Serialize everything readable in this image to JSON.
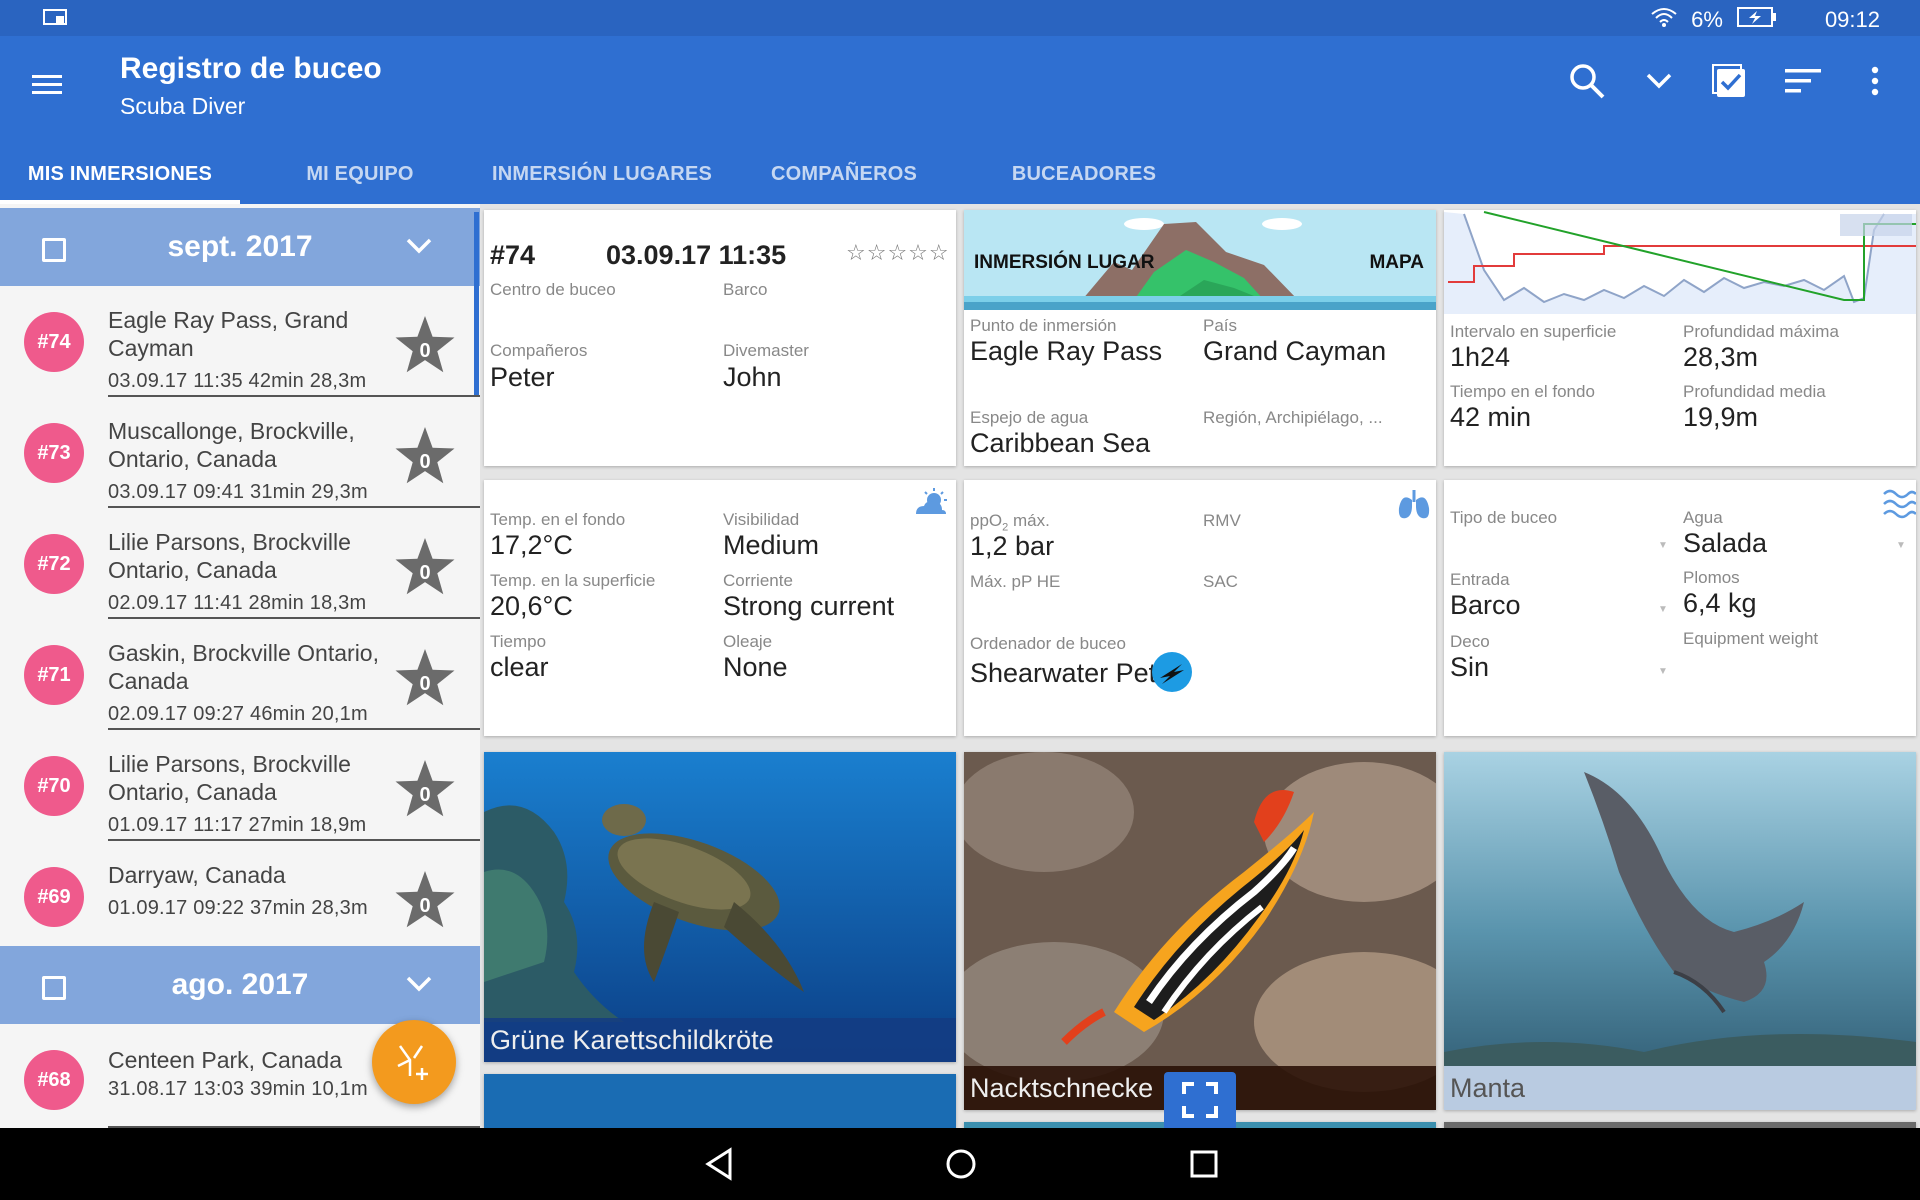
{
  "status_bar": {
    "battery": "6%",
    "time": "09:12"
  },
  "app": {
    "title": "Registro de buceo",
    "subtitle": "Scuba Diver"
  },
  "tabs": [
    "MIS INMERSIONES",
    "MI EQUIPO",
    "INMERSIÓN LUGARES",
    "COMPAÑEROS",
    "BUCEADORES"
  ],
  "months": [
    "sept. 2017",
    "ago. 2017"
  ],
  "dives": [
    {
      "num": "#74",
      "name": "Eagle Ray Pass, Grand Cayman",
      "meta": "03.09.17  11:35  42min  28,3m",
      "rating": "0"
    },
    {
      "num": "#73",
      "name": "Muscallonge, Brockville, Ontario, Canada",
      "meta": "03.09.17  09:41  31min  29,3m",
      "rating": "0"
    },
    {
      "num": "#72",
      "name": "Lilie Parsons, Brockville Ontario, Canada",
      "meta": "02.09.17  11:41  28min  18,3m",
      "rating": "0"
    },
    {
      "num": "#71",
      "name": "Gaskin, Brockville Ontario, Canada",
      "meta": "02.09.17  09:27  46min  20,1m",
      "rating": "0"
    },
    {
      "num": "#70",
      "name": "Lilie Parsons, Brockville Ontario, Canada",
      "meta": "01.09.17  11:17  27min  18,9m",
      "rating": "0"
    },
    {
      "num": "#69",
      "name": "Darryaw, Canada",
      "meta": "01.09.17  09:22  37min  28,3m",
      "rating": "0"
    },
    {
      "num": "#68",
      "name": "Centeen Park, Canada",
      "meta": "31.08.17  13:03  39min  10,1m",
      "rating": "0"
    }
  ],
  "detail": {
    "num": "#74",
    "datetime": "03.09.17  11:35",
    "stars": "☆☆☆☆☆",
    "dive_center_label": "Centro de buceo",
    "boat_label": "Barco",
    "buddies_label": "Compañeros",
    "buddies": "Peter",
    "divemaster_label": "Divemaster",
    "divemaster": "John"
  },
  "site": {
    "banner_left": "INMERSIÓN LUGAR",
    "banner_right": "MAPA",
    "point_label": "Punto de inmersión",
    "point": "Eagle Ray Pass",
    "country_label": "País",
    "country": "Grand Cayman",
    "water_label": "Espejo de agua",
    "water": "Caribbean Sea",
    "region_label": "Región, Archipiélago, ..."
  },
  "profile": {
    "surface_interval_label": "Intervalo en superficie",
    "surface_interval": "1h24",
    "max_depth_label": "Profundidad máxima",
    "max_depth": "28,3m",
    "bottom_time_label": "Tiempo en el fondo",
    "bottom_time": "42 min",
    "avg_depth_label": "Profundidad media",
    "avg_depth": "19,9m"
  },
  "conditions": {
    "bottom_temp_label": "Temp. en el fondo",
    "bottom_temp": "17,2°C",
    "visibility_label": "Visibilidad",
    "visibility": "Medium",
    "surface_temp_label": "Temp. en la superficie",
    "surface_temp": "20,6°C",
    "current_label": "Corriente",
    "current": "Strong current",
    "weather_label": "Tiempo",
    "weather": "clear",
    "swell_label": "Oleaje",
    "swell": "None"
  },
  "gas": {
    "ppo2_label_a": "ppO",
    "ppo2_label_sub": "2",
    "ppo2_label_b": " máx.",
    "ppo2": "1,2 bar",
    "rmv_label": "RMV",
    "pphe_label": "Máx. pP HE",
    "sac_label": "SAC",
    "computer_label": "Ordenador de buceo",
    "computer": "Shearwater Pet"
  },
  "divetype": {
    "type_label": "Tipo de buceo",
    "water_label": "Agua",
    "water": "Salada",
    "entry_label": "Entrada",
    "entry": "Barco",
    "weights_label": "Plomos",
    "weights": "6,4 kg",
    "equipment_weight_label": "Equipment weight",
    "deco_label": "Deco",
    "deco": "Sin"
  },
  "photos": [
    "Grüne Karettschildkröte",
    "Nacktschnecke",
    "Manta"
  ],
  "colors": {
    "status_bar": "#2a64c0",
    "app_bar": "#2f6fd1",
    "month_header": "#82a6dc",
    "dive_badge": "#ef5a8c",
    "fab": "#f39a1e"
  }
}
